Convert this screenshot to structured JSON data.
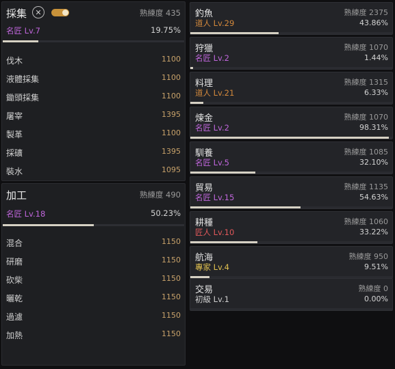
{
  "gather": {
    "title": "採集",
    "proficiency": "熟練度 435",
    "grade": "名匠 Lv.7",
    "percent": "19.75%",
    "progress": 0.1975,
    "accent_color": "#c066dc",
    "items": [
      {
        "name": "伐木",
        "value": "1100"
      },
      {
        "name": "液體採集",
        "value": "1100"
      },
      {
        "name": "鋤頭採集",
        "value": "1100"
      },
      {
        "name": "屠宰",
        "value": "1395"
      },
      {
        "name": "製革",
        "value": "1100"
      },
      {
        "name": "採礦",
        "value": "1395"
      },
      {
        "name": "裝水",
        "value": "1095"
      }
    ]
  },
  "process": {
    "title": "加工",
    "proficiency": "熟練度 490",
    "grade": "名匠 Lv.18",
    "percent": "50.23%",
    "progress": 0.5023,
    "items": [
      {
        "name": "混合",
        "value": "1150"
      },
      {
        "name": "研磨",
        "value": "1150"
      },
      {
        "name": "砍柴",
        "value": "1150"
      },
      {
        "name": "曬乾",
        "value": "1150"
      },
      {
        "name": "過濾",
        "value": "1150"
      },
      {
        "name": "加熱",
        "value": "1150"
      }
    ]
  },
  "skills": [
    {
      "name": "釣魚",
      "proficiency": "熟練度 2375",
      "grade": "道人 Lv.29",
      "grade_color": "#d2883c",
      "percent": "43.86%",
      "progress": 0.4386
    },
    {
      "name": "狩獵",
      "proficiency": "熟練度 1070",
      "grade": "名匠 Lv.2",
      "grade_color": "#c066dc",
      "percent": "1.44%",
      "progress": 0.0144
    },
    {
      "name": "料理",
      "proficiency": "熟練度 1315",
      "grade": "道人 Lv.21",
      "grade_color": "#d2883c",
      "percent": "6.33%",
      "progress": 0.0633
    },
    {
      "name": "煉金",
      "proficiency": "熟練度 1070",
      "grade": "名匠 Lv.2",
      "grade_color": "#c066dc",
      "percent": "98.31%",
      "progress": 0.9831
    },
    {
      "name": "馴養",
      "proficiency": "熟練度 1085",
      "grade": "名匠 Lv.5",
      "grade_color": "#c066dc",
      "percent": "32.10%",
      "progress": 0.321
    },
    {
      "name": "貿易",
      "proficiency": "熟練度 1135",
      "grade": "名匠 Lv.15",
      "grade_color": "#c066dc",
      "percent": "54.63%",
      "progress": 0.5463
    },
    {
      "name": "耕種",
      "proficiency": "熟練度 1060",
      "grade": "匠人 Lv.10",
      "grade_color": "#e0585a",
      "percent": "33.22%",
      "progress": 0.3322
    },
    {
      "name": "航海",
      "proficiency": "熟練度 950",
      "grade": "專家 Lv.4",
      "grade_color": "#e2c250",
      "percent": "9.51%",
      "progress": 0.0951
    },
    {
      "name": "交易",
      "proficiency": "熟練度 0",
      "grade": "初級 Lv.1",
      "grade_color": "#cfcfcf",
      "percent": "0.00%",
      "progress": 0.0
    }
  ]
}
